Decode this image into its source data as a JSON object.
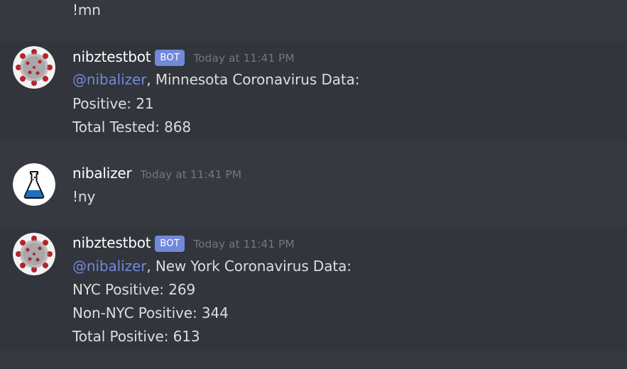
{
  "messages": [
    {
      "content_lines": [
        "!mn"
      ]
    },
    {
      "author": "nibztestbot",
      "bot_tag": "BOT",
      "timestamp": "Today at 11:41 PM",
      "mention": "@nibalizer",
      "first_line_rest": ", Minnesota Coronavirus Data:",
      "content_lines": [
        "Positive: 21",
        "Total Tested: 868"
      ]
    },
    {
      "author": "nibalizer",
      "timestamp": "Today at 11:41 PM",
      "content_lines": [
        "!ny"
      ]
    },
    {
      "author": "nibztestbot",
      "bot_tag": "BOT",
      "timestamp": "Today at 11:41 PM",
      "mention": "@nibalizer",
      "first_line_rest": ", New York Coronavirus Data:",
      "content_lines": [
        "NYC Positive: 269",
        "Non-NYC Positive: 344",
        "Total Positive: 613"
      ]
    }
  ],
  "colors": {
    "background": "#36393f",
    "highlight": "#32353b",
    "text": "#dcddde",
    "username": "#ffffff",
    "timestamp": "#72767d",
    "mention": "#7289da",
    "bot_tag": "#7289da"
  },
  "icons": {
    "bot_avatar": "coronavirus-avatar-icon",
    "user_avatar": "erlenmeyer-flask-avatar-icon"
  }
}
